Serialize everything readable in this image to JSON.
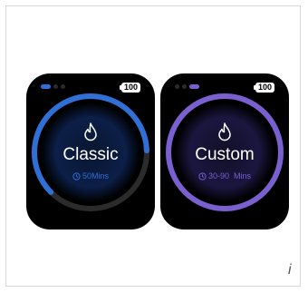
{
  "screens": [
    {
      "pager_active_index": 0,
      "battery": "100",
      "icon": "flame-icon",
      "mode_label": "Classic",
      "duration_icon": "clock-icon",
      "duration_text": "50Mins",
      "accent_color": "#2f6fd6",
      "ring_progress": 0.62
    },
    {
      "pager_active_index": 1,
      "battery": "100",
      "icon": "flame-icon",
      "mode_label": "Custom",
      "duration_icon": "clock-icon",
      "duration_text": "30-90  Mins",
      "accent_color": "#7a5fd0",
      "ring_progress": 1.0
    }
  ],
  "corner_glyph": "i"
}
